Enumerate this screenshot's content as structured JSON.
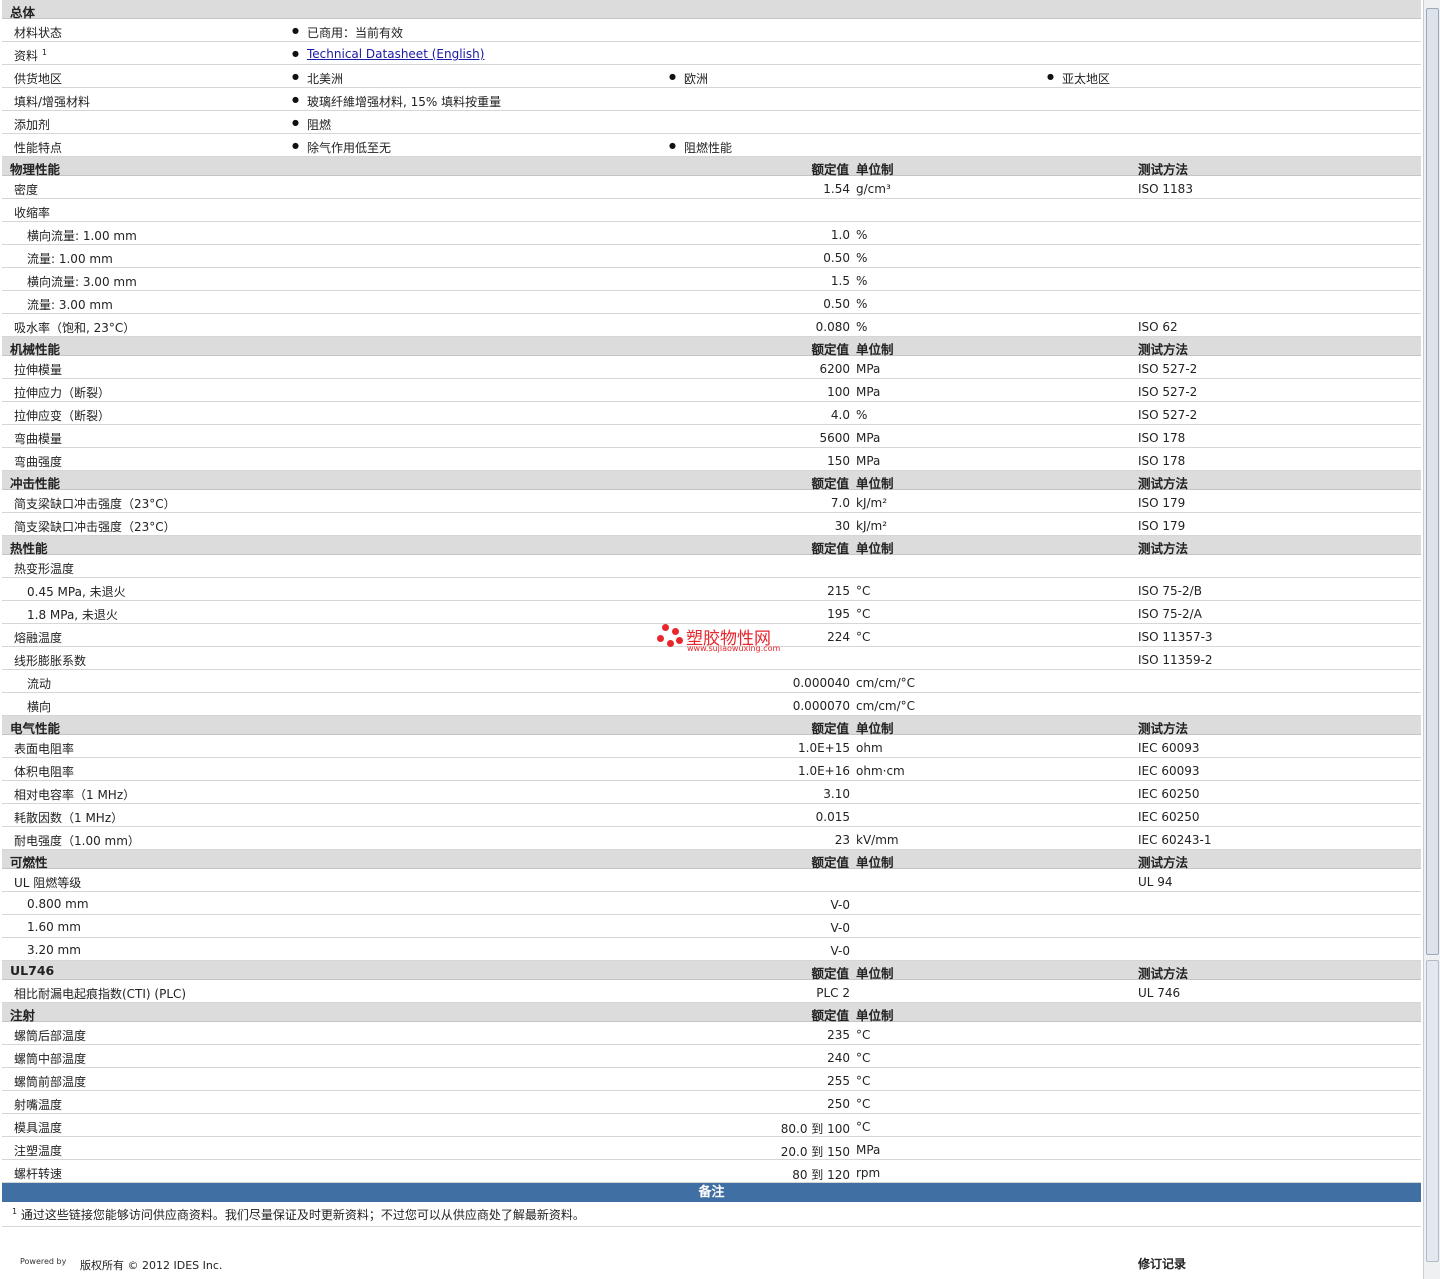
{
  "general": {
    "title": "总体",
    "status_label": "材料状态",
    "status_value": "已商用：当前有效",
    "docs_label": "资料",
    "docs_sup": "1",
    "docs_link": "Technical Datasheet (English)",
    "regions_label": "供货地区",
    "regions": [
      "北美洲",
      "欧洲",
      "亚太地区"
    ],
    "filler_label": "填料/增强材料",
    "filler_value": "玻璃纤維增强材料, 15% 填料按重量",
    "additive_label": "添加剂",
    "additive_value": "阻燃",
    "features_label": "性能特点",
    "features": [
      "除气作用低至无",
      "阻燃性能"
    ]
  },
  "headers": {
    "value": "额定值",
    "unit": "单位制",
    "test": "测试方法"
  },
  "physical": {
    "title": "物理性能",
    "rows": [
      {
        "label": "密度",
        "value": "1.54",
        "unit": "g/cm³",
        "test": "ISO 1183"
      },
      {
        "label": "收缩率",
        "value": "",
        "unit": "",
        "test": ""
      },
      {
        "label": "横向流量: 1.00 mm",
        "value": "1.0",
        "unit": "%",
        "test": ""
      },
      {
        "label": "流量: 1.00 mm",
        "value": "0.50",
        "unit": "%",
        "test": ""
      },
      {
        "label": "横向流量: 3.00 mm",
        "value": "1.5",
        "unit": "%",
        "test": ""
      },
      {
        "label": "流量: 3.00 mm",
        "value": "0.50",
        "unit": "%",
        "test": ""
      },
      {
        "label": "吸水率（饱和, 23°C）",
        "value": "0.080",
        "unit": "%",
        "test": "ISO 62"
      }
    ]
  },
  "mechanical": {
    "title": "机械性能",
    "rows": [
      {
        "label": "拉伸模量",
        "value": "6200",
        "unit": "MPa",
        "test": "ISO 527-2"
      },
      {
        "label": "拉伸应力（断裂）",
        "value": "100",
        "unit": "MPa",
        "test": "ISO 527-2"
      },
      {
        "label": "拉伸应变（断裂）",
        "value": "4.0",
        "unit": "%",
        "test": "ISO 527-2"
      },
      {
        "label": "弯曲模量",
        "value": "5600",
        "unit": "MPa",
        "test": "ISO 178"
      },
      {
        "label": "弯曲强度",
        "value": "150",
        "unit": "MPa",
        "test": "ISO 178"
      }
    ]
  },
  "impact": {
    "title": "冲击性能",
    "rows": [
      {
        "label": "简支梁缺口冲击强度（23°C）",
        "value": "7.0",
        "unit": "kJ/m²",
        "test": "ISO 179"
      },
      {
        "label": "简支梁缺口冲击强度（23°C）",
        "value": "30",
        "unit": "kJ/m²",
        "test": "ISO 179"
      }
    ]
  },
  "thermal": {
    "title": "热性能",
    "rows": [
      {
        "label": "热变形温度",
        "value": "",
        "unit": "",
        "test": ""
      },
      {
        "label": "0.45 MPa, 未退火",
        "value": "215",
        "unit": "°C",
        "test": "ISO 75-2/B"
      },
      {
        "label": "1.8 MPa, 未退火",
        "value": "195",
        "unit": "°C",
        "test": "ISO 75-2/A"
      },
      {
        "label": "熔融温度",
        "value": "224",
        "unit": "°C",
        "test": "ISO 11357-3"
      },
      {
        "label": "线形膨胀系数",
        "value": "",
        "unit": "",
        "test": "ISO 11359-2"
      },
      {
        "label": "流动",
        "value": "0.000040",
        "unit": "cm/cm/°C",
        "test": ""
      },
      {
        "label": "横向",
        "value": "0.000070",
        "unit": "cm/cm/°C",
        "test": ""
      }
    ]
  },
  "electrical": {
    "title": "电气性能",
    "rows": [
      {
        "label": "表面电阻率",
        "value": "1.0E+15",
        "unit": "ohm",
        "test": "IEC 60093"
      },
      {
        "label": "体积电阻率",
        "value": "1.0E+16",
        "unit": "ohm·cm",
        "test": "IEC 60093"
      },
      {
        "label": "相对电容率（1 MHz）",
        "value": "3.10",
        "unit": "",
        "test": "IEC 60250"
      },
      {
        "label": "耗散因数（1 MHz）",
        "value": "0.015",
        "unit": "",
        "test": "IEC 60250"
      },
      {
        "label": "耐电强度（1.00 mm）",
        "value": "23",
        "unit": "kV/mm",
        "test": "IEC 60243-1"
      }
    ]
  },
  "flammability": {
    "title": "可燃性",
    "rows": [
      {
        "label": "UL 阻燃等级",
        "value": "",
        "unit": "",
        "test": "UL 94"
      },
      {
        "label": "0.800 mm",
        "value": "V-0",
        "unit": "",
        "test": ""
      },
      {
        "label": "1.60 mm",
        "value": "V-0",
        "unit": "",
        "test": ""
      },
      {
        "label": "3.20 mm",
        "value": "V-0",
        "unit": "",
        "test": ""
      }
    ]
  },
  "ul746": {
    "title": "UL746",
    "rows": [
      {
        "label": "相比耐漏电起痕指数(CTI) (PLC)",
        "value": "PLC 2",
        "unit": "",
        "test": "UL 746"
      }
    ]
  },
  "injection": {
    "title": "注射",
    "rows": [
      {
        "label": "螺筒后部温度",
        "value": "235",
        "unit": "°C",
        "test": ""
      },
      {
        "label": "螺筒中部温度",
        "value": "240",
        "unit": "°C",
        "test": ""
      },
      {
        "label": "螺筒前部温度",
        "value": "255",
        "unit": "°C",
        "test": ""
      },
      {
        "label": "射嘴温度",
        "value": "250",
        "unit": "°C",
        "test": ""
      },
      {
        "label": "模具温度",
        "value": "80.0 到  100",
        "unit": "°C",
        "test": ""
      },
      {
        "label": "注塑温度",
        "value": "20.0 到  150",
        "unit": "MPa",
        "test": ""
      },
      {
        "label": "螺杆转速",
        "value": "80 到  120",
        "unit": "rpm",
        "test": ""
      }
    ]
  },
  "notes": {
    "title": "备注",
    "sup": "1",
    "text": "通过这些链接您能够访问供应商资料。我们尽量保证及时更新资料；不过您可以从供应商处了解最新资料。"
  },
  "footer": {
    "powered": "Powered by",
    "copyright": "版权所有 © 2012 IDES Inc.",
    "revision": "修订记录"
  },
  "watermark": {
    "title": "塑胶物性网",
    "url": "www.sujiaowuxing.com"
  },
  "colors": {
    "section_bg": "#dcdcdc",
    "notes_bar": "#3f6fa3",
    "link": "#1a1aa6",
    "watermark": "#e8262d"
  }
}
